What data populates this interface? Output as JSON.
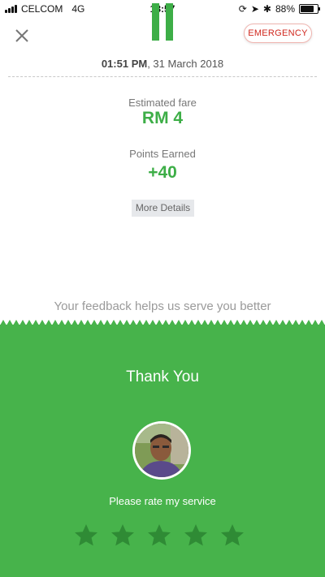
{
  "status_bar": {
    "carrier": "CELCOM",
    "network": "4G",
    "time": "13:57",
    "battery_percent": "88%",
    "battery_level": 0.88
  },
  "header": {
    "emergency_label": "EMERGENCY",
    "time": "01:51 PM",
    "date": ", 31 March 2018"
  },
  "fare": {
    "label": "Estimated fare",
    "value": "RM 4"
  },
  "points": {
    "label": "Points Earned",
    "value": "+40"
  },
  "more_details_label": "More Details",
  "feedback_prompt": "Your feedback helps us serve you better",
  "rating_panel": {
    "title": "Thank You",
    "rate_prompt": "Please rate my service",
    "star_count": 5
  },
  "colors": {
    "brand_green": "#47b34b",
    "accent_green": "#3dae47",
    "emergency_red": "#d0271d"
  },
  "icons": [
    "close-icon",
    "signal-icon",
    "pause-icon",
    "location-icon",
    "bluetooth-icon",
    "battery-icon",
    "star-icon"
  ]
}
